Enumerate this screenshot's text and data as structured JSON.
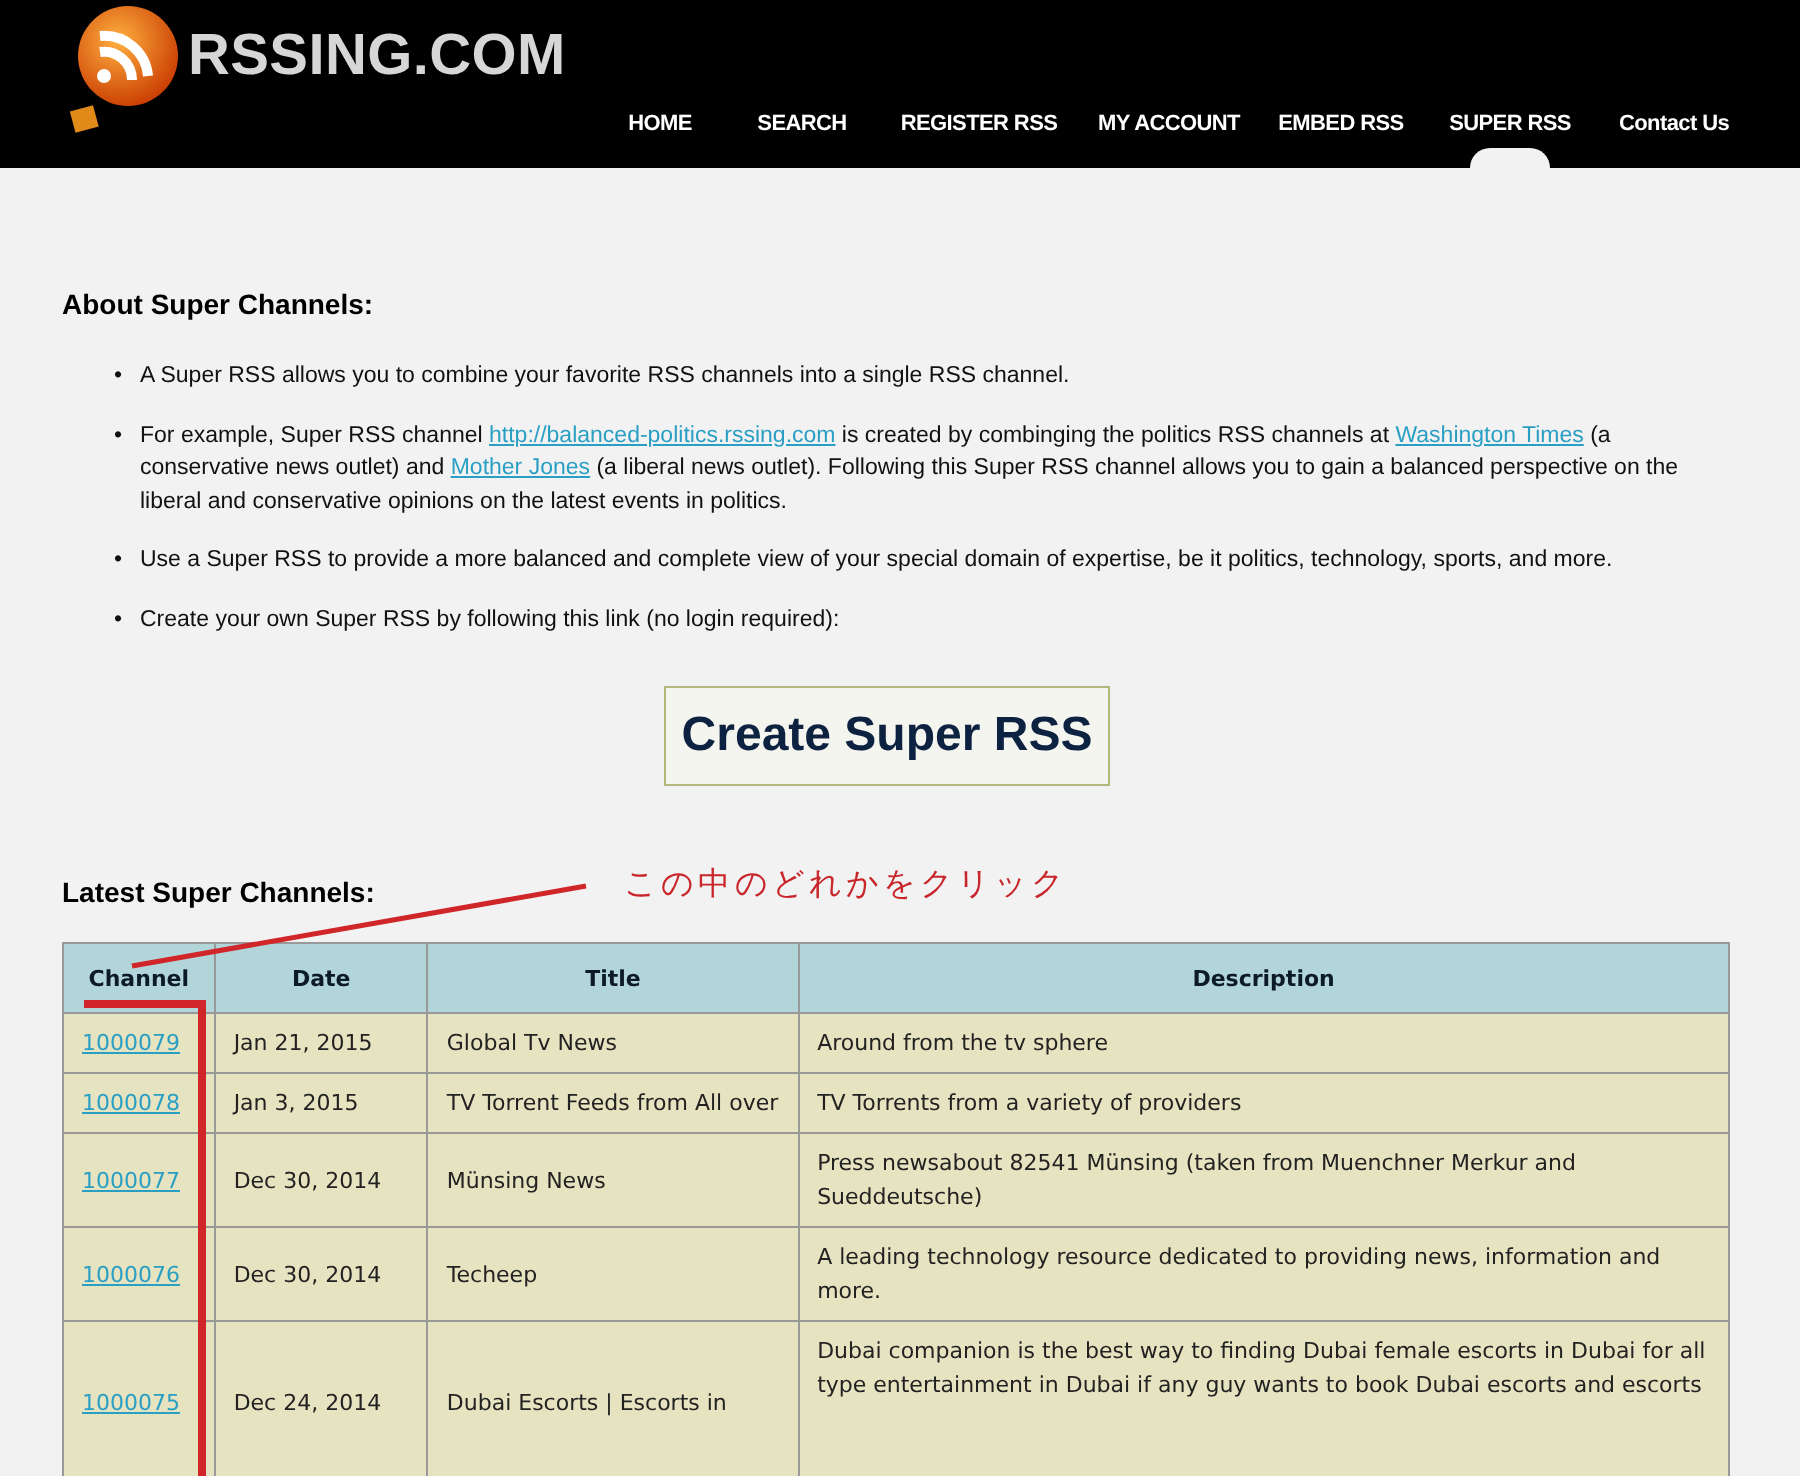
{
  "site": {
    "name": "RSSING.COM"
  },
  "nav": [
    {
      "label": "HOME",
      "selected": false
    },
    {
      "label": "SEARCH",
      "selected": false
    },
    {
      "label": "REGISTER RSS",
      "selected": false
    },
    {
      "label": "MY ACCOUNT",
      "selected": false
    },
    {
      "label": "EMBED RSS",
      "selected": false
    },
    {
      "label": "SUPER RSS",
      "selected": true
    },
    {
      "label": "Contact Us",
      "selected": false
    }
  ],
  "about": {
    "heading": "About Super Channels:",
    "bullets": [
      {
        "marker": "•",
        "segments": [
          {
            "kind": "text",
            "text": "A Super RSS allows you to combine your favorite RSS channels into a single RSS channel."
          }
        ]
      },
      {
        "marker": "•",
        "segments": [
          {
            "kind": "text",
            "text": "For example, Super RSS channel "
          },
          {
            "kind": "link",
            "text": "http://balanced-politics.rssing.com"
          },
          {
            "kind": "text",
            "text": " is created by combinging the politics RSS channels at "
          },
          {
            "kind": "link",
            "text": "Washington Times"
          },
          {
            "kind": "text",
            "text": " (a conservative news outlet) and "
          },
          {
            "kind": "link",
            "text": "Mother Jones"
          },
          {
            "kind": "text",
            "text": " (a liberal news outlet). Following this Super RSS channel allows you to gain a balanced perspective on the liberal and conservative opinions on the latest events in politics."
          }
        ]
      },
      {
        "marker": "•",
        "segments": [
          {
            "kind": "text",
            "text": "Use a Super RSS to provide a more balanced and complete view of your special domain of expertise, be it politics, technology, sports, and more."
          }
        ]
      },
      {
        "marker": "•",
        "segments": [
          {
            "kind": "text",
            "text": "Create your own Super RSS by following this link (no login required):"
          }
        ]
      }
    ]
  },
  "create_button": "Create Super RSS",
  "latest": {
    "heading": "Latest Super Channels:",
    "annotation": "この中のどれかをクリック"
  },
  "table": {
    "columns": [
      "Channel",
      "Date",
      "Title",
      "Description"
    ],
    "rows": [
      {
        "channel": "1000079",
        "date": "Jan 21, 2015",
        "title": "Global Tv News",
        "description": "Around from the tv sphere"
      },
      {
        "channel": "1000078",
        "date": "Jan 3, 2015",
        "title": "TV Torrent Feeds from All over",
        "description": "TV Torrents from a variety of providers"
      },
      {
        "channel": "1000077",
        "date": "Dec 30, 2014",
        "title": "Münsing News",
        "description": "Press newsabout 82541 Münsing (taken from Muenchner Merkur and Sueddeutsche)"
      },
      {
        "channel": "1000076",
        "date": "Dec 30, 2014",
        "title": "Techeep",
        "description": "A leading technology resource dedicated to providing news, information and more."
      },
      {
        "channel": "1000075",
        "date": "Dec 24, 2014",
        "title": "Dubai Escorts | Escorts in",
        "description": "Dubai companion is the best way to finding Dubai female escorts in Dubai for all type entertainment in Dubai if any guy wants to book Dubai escorts and escorts"
      }
    ]
  }
}
